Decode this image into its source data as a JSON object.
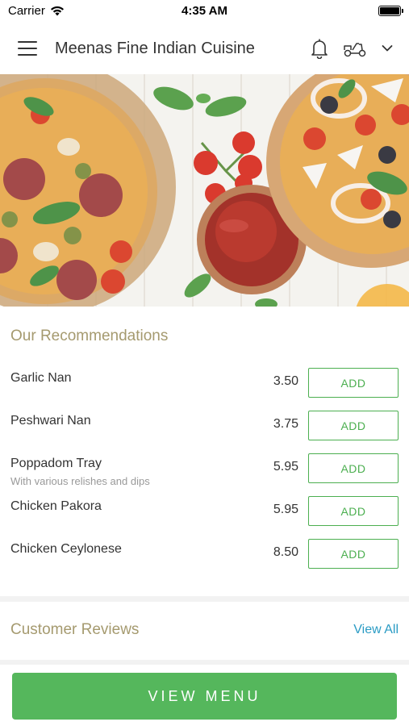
{
  "status_bar": {
    "carrier": "Carrier",
    "time": "4:35 AM"
  },
  "header": {
    "title": "Meenas Fine Indian Cuisine",
    "icons": [
      "hamburger-menu-icon",
      "bell-icon",
      "delivery-scooter-icon",
      "chevron-down-icon"
    ]
  },
  "hero": {
    "image": "pizzas-tomatoes-ketchup-photo"
  },
  "recommendations": {
    "title": "Our Recommendations",
    "items": [
      {
        "name": "Garlic Nan",
        "description": "",
        "price": "3.50",
        "button": "ADD"
      },
      {
        "name": "Peshwari Nan",
        "description": "",
        "price": "3.75",
        "button": "ADD"
      },
      {
        "name": "Poppadom Tray",
        "description": "With various relishes and dips",
        "price": "5.95",
        "button": "ADD"
      },
      {
        "name": "Chicken Pakora",
        "description": "",
        "price": "5.95",
        "button": "ADD"
      },
      {
        "name": "Chicken Ceylonese",
        "description": "",
        "price": "8.50",
        "button": "ADD"
      }
    ]
  },
  "reviews": {
    "title": "Customer Reviews",
    "view_all": "View All"
  },
  "footer": {
    "view_menu": "VIEW MENU"
  },
  "colors": {
    "accent_green": "#55b75c",
    "section_title": "#a59a6f",
    "link_blue": "#2a9bc4"
  }
}
